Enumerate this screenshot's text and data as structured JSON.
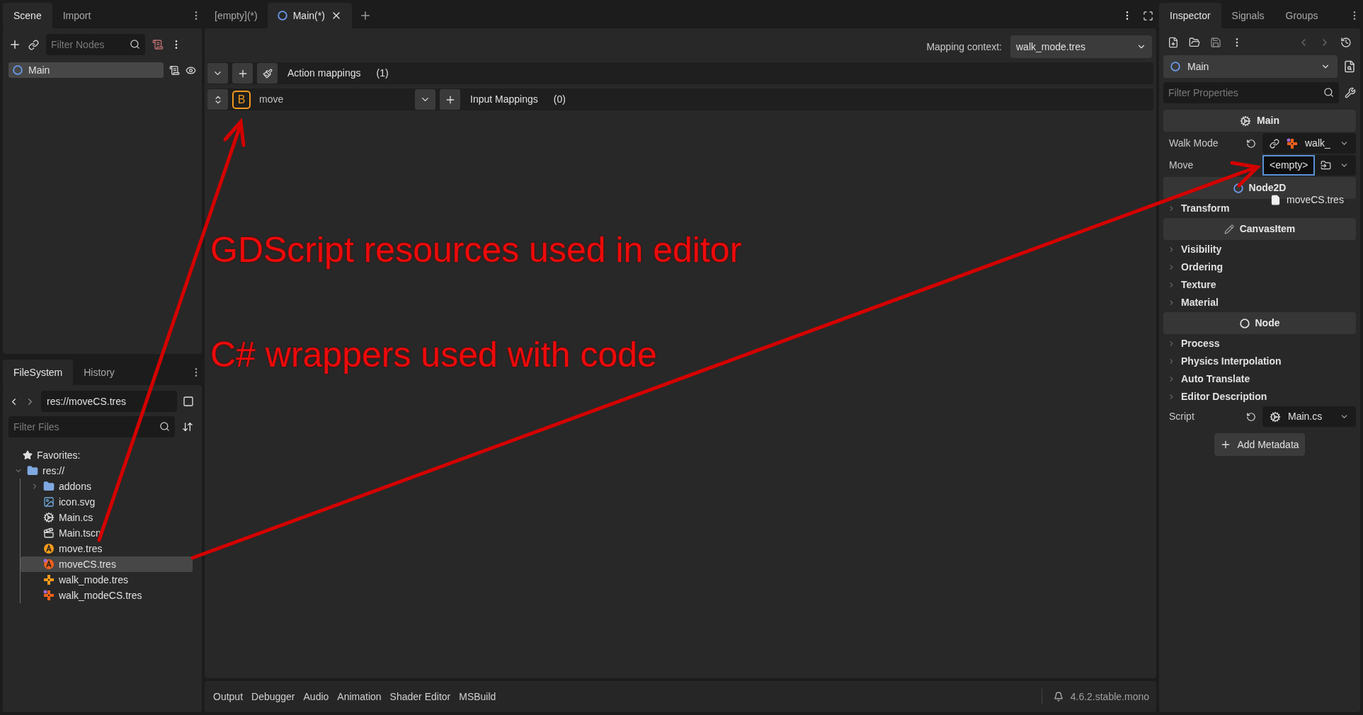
{
  "scene_dock": {
    "tabs": [
      {
        "label": "Scene",
        "selected": true
      },
      {
        "label": "Import",
        "selected": false
      }
    ],
    "filter_placeholder": "Filter Nodes",
    "nodes": [
      {
        "name": "Main",
        "selected": true
      }
    ]
  },
  "filesystem_dock": {
    "tabs": [
      {
        "label": "FileSystem",
        "selected": true
      },
      {
        "label": "History",
        "selected": false
      }
    ],
    "path": "res://moveCS.tres",
    "filter_placeholder": "Filter Files",
    "favorites": "Favorites:",
    "tree": [
      {
        "name": "res://",
        "kind": "folder",
        "expanded": true,
        "selected": false,
        "children": [
          {
            "name": "addons",
            "kind": "folder",
            "expanded": false,
            "selected": false
          },
          {
            "name": "icon.svg",
            "kind": "image",
            "selected": false
          },
          {
            "name": "Main.cs",
            "kind": "script",
            "selected": false
          },
          {
            "name": "Main.tscn",
            "kind": "scene",
            "selected": false
          },
          {
            "name": "move.tres",
            "kind": "action",
            "selected": false
          },
          {
            "name": "moveCS.tres",
            "kind": "action_cs",
            "selected": true
          },
          {
            "name": "walk_mode.tres",
            "kind": "context",
            "selected": false
          },
          {
            "name": "walk_modeCS.tres",
            "kind": "context_cs",
            "selected": false
          }
        ]
      }
    ]
  },
  "editor_tabs": [
    {
      "label": "[empty](*)",
      "selected": false
    },
    {
      "label": "Main(*)",
      "selected": true
    }
  ],
  "mapping_context": {
    "label": "Mapping context:",
    "value": "walk_mode.tres"
  },
  "action_mappings": {
    "title": "Action mappings",
    "count": "(1)",
    "actions": [
      {
        "key": "B",
        "name": "move",
        "inputs_title": "Input Mappings",
        "inputs_count": "(0)"
      }
    ]
  },
  "annotations": [
    "GDScript resources used in editor",
    "C# wrappers used with code"
  ],
  "bottom_panel": {
    "tabs": [
      "Output",
      "Debugger",
      "Audio",
      "Animation",
      "Shader Editor",
      "MSBuild"
    ],
    "version": "4.6.2.stable.mono"
  },
  "inspector": {
    "tabs": [
      {
        "label": "Inspector",
        "selected": true
      },
      {
        "label": "Signals",
        "selected": false
      },
      {
        "label": "Groups",
        "selected": false
      }
    ],
    "node": "Main",
    "filter_placeholder": "Filter Properties",
    "drag_label": "moveCS.tres",
    "items": [
      {
        "kind": "scriptclass",
        "label": "Main"
      },
      {
        "kind": "resource",
        "label": "Walk Mode",
        "value": "walk_",
        "revertable": true
      },
      {
        "kind": "emptyresource",
        "label": "Move",
        "value": "<empty>",
        "revertable": false,
        "focused": true
      },
      {
        "kind": "node2dclass",
        "label": "Node2D"
      },
      {
        "kind": "group",
        "label": "Transform"
      },
      {
        "kind": "canvasclass",
        "label": "CanvasItem"
      },
      {
        "kind": "group",
        "label": "Visibility"
      },
      {
        "kind": "group",
        "label": "Ordering"
      },
      {
        "kind": "group",
        "label": "Texture"
      },
      {
        "kind": "group",
        "label": "Material"
      },
      {
        "kind": "nodeclass",
        "label": "Node"
      },
      {
        "kind": "group",
        "label": "Process"
      },
      {
        "kind": "group",
        "label": "Physics Interpolation"
      },
      {
        "kind": "group",
        "label": "Auto Translate"
      },
      {
        "kind": "group",
        "label": "Editor Description"
      },
      {
        "kind": "script",
        "label": "Script",
        "value": "Main.cs",
        "revertable": true
      },
      {
        "kind": "button",
        "label": "Add Metadata"
      }
    ]
  }
}
